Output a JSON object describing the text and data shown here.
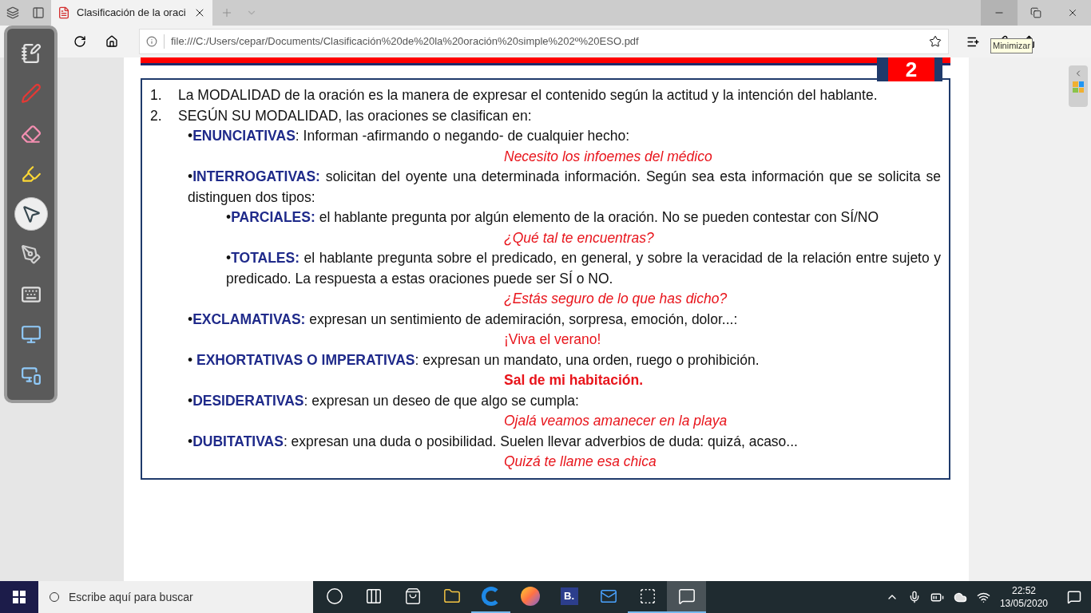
{
  "browser": {
    "tab": {
      "title": "Clasificación de la oraci",
      "selected": true
    },
    "window_controls": [
      {
        "kind": "minimize",
        "hovered": true
      },
      {
        "kind": "restore",
        "hovered": false
      },
      {
        "kind": "close",
        "hovered": false
      }
    ],
    "tooltip": "Minimizar",
    "address": "file:///C:/Users/cepar/Documents/Clasificación%20de%20la%20oración%20simple%202º%20ESO.pdf"
  },
  "annotation_toolbar": [
    {
      "kind": "whiteboard",
      "selected": false
    },
    {
      "kind": "pen",
      "selected": false
    },
    {
      "kind": "eraser",
      "selected": false
    },
    {
      "kind": "highlighter",
      "selected": false
    },
    {
      "kind": "pointer",
      "selected": true
    },
    {
      "kind": "laser",
      "selected": false
    },
    {
      "kind": "keyboard",
      "selected": false
    },
    {
      "kind": "capture",
      "selected": false
    },
    {
      "kind": "screen",
      "selected": false
    }
  ],
  "document": {
    "page_number": "2",
    "items": [
      {
        "num": "1.",
        "text": "La MODALIDAD de la oración es la manera de expresar el contenido según la actitud y la intención del hablante."
      },
      {
        "num": "2.",
        "text": "SEGÚN SU MODALIDAD, las oraciones se clasifican en:",
        "bullets": [
          {
            "bullet": "•",
            "term": "ENUNCIATIVAS",
            "text": ": Informan -afirmando o negando- de cualquier hecho:",
            "example": {
              "text": "Necesito los infoemes del médico",
              "kind": "italic"
            }
          },
          {
            "bullet": "•",
            "term": "INTERROGATIVAS:",
            "text": " solicitan del oyente una determinada información. Según sea esta información que se solicita se distinguen dos tipos:",
            "children": [
              {
                "bullet": "•",
                "term": "PARCIALES:",
                "text": " el hablante pregunta por algún elemento de la oración. No se pueden contestar con SÍ/NO",
                "example": {
                  "text": "¿Qué tal te encuentras?",
                  "kind": "italic"
                }
              },
              {
                "bullet": "•",
                "term": "TOTALES:",
                "text": " el hablante pregunta sobre el predicado, en general, y sobre la veracidad de la relación entre sujeto y predicado. La respuesta a estas oraciones puede ser SÍ o NO.",
                "example": {
                  "text": "¿Estás seguro de lo que has dicho?",
                  "kind": "italic"
                }
              }
            ]
          },
          {
            "bullet": "•",
            "term": "EXCLAMATIVAS:",
            "text": " expresan un sentimiento de ademiración, sorpresa, emoción, dolor...:",
            "example": {
              "text": "¡Viva el verano!",
              "kind": "plain"
            }
          },
          {
            "bullet": "• ",
            "term": "EXHORTATIVAS O IMPERATIVAS",
            "text": ": expresan un mandato, una orden, ruego o prohibición.",
            "example": {
              "text": "Sal de mi habitación.",
              "kind": "bold"
            }
          },
          {
            "bullet": "•",
            "term": "DESIDERATIVAS",
            "text": ": expresan un deseo de que algo se cumpla:",
            "example": {
              "text": "Ojalá veamos amanecer en la playa",
              "kind": "italic"
            }
          },
          {
            "bullet": "•",
            "term": "DUBITATIVAS",
            "text": ": expresan una duda o posibilidad. Suelen llevar adverbios de duda: quizá, acaso...",
            "example": {
              "text": "Quizá te llame esa chica",
              "kind": "italic"
            }
          }
        ]
      }
    ]
  },
  "taskbar": {
    "search_placeholder": "Escribe aquí para buscar",
    "apps": [
      {
        "kind": "cortana",
        "running": false,
        "active": false
      },
      {
        "kind": "taskview",
        "running": false,
        "active": false
      },
      {
        "kind": "store",
        "running": false,
        "active": false
      },
      {
        "kind": "files",
        "running": false,
        "active": false
      },
      {
        "kind": "edge",
        "running": true,
        "active": false
      },
      {
        "kind": "firefox",
        "running": false,
        "active": false
      },
      {
        "kind": "booking",
        "running": false,
        "active": false
      },
      {
        "kind": "mail",
        "running": false,
        "active": false
      },
      {
        "kind": "snip",
        "running": true,
        "active": false
      },
      {
        "kind": "annotate",
        "running": true,
        "active": true
      }
    ],
    "booking_letter": "B.",
    "time": "22:52",
    "date": "13/05/2020"
  }
}
